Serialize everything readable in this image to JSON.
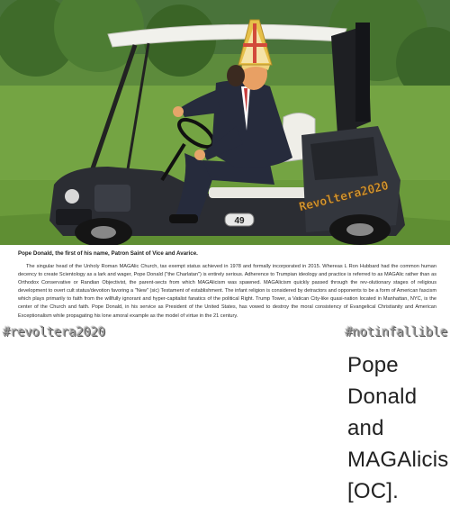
{
  "meme": {
    "cart_watermark": "Revoltera2020",
    "cart_number": "49",
    "caption_title": "Pope Donald, the first of his name, Patron Saint of Vice and Avarice.",
    "caption_body": "The singular head of the Unholy Roman MAGAlic Church, tax exempt status achieved in 1978 and formally incorporated in 2015.  Whereas L Ron Hubbard had the common human decency to create Scientology as a lark and wager, Pope Donald (\"the Charlatan\") is entirely serious. Adherence to Trumpian ideology and practice is referred to as MAGAlic rather than as Orthodox Conservative or Randian Objectivist, the parent-sects from which MAGAlicism was spawned. MAGAlicism quickly passed through the rev-olutionary stages of religious development to overt cult status/devotion favoring a \"New\" (sic) Testament of establishment. The infant religion is considered by detractors and opponents to be a form of American fascism which plays primarily to faith from the willfully ignorant and hyper-capitalist fanatics of the political Right. Trump Tower, a Vatican City-like quasi-nation located in Manhattan, NYC, is the center of the Church and faith. Pope Donald, in his service as President of the United States, has vowed to destroy the moral consistency of Evangelical Christianity and American Exceptionalism while propagating his lone amoral example as the model of virtue in the 21 century.",
    "hashtag_left": "#revoltera2020",
    "hashtag_right": "#notinfallible"
  },
  "post": {
    "title": "Pope Donald and MAGAlicism [OC]."
  },
  "colors": {
    "grass": "#6f9e3f",
    "trees": "#3f6b2a",
    "cart_body": "#2b2d33",
    "canopy": "#f1f1ec",
    "mitre_gold": "#e6c04a",
    "suit": "#262b3c",
    "watermark": "#d9a13a"
  }
}
